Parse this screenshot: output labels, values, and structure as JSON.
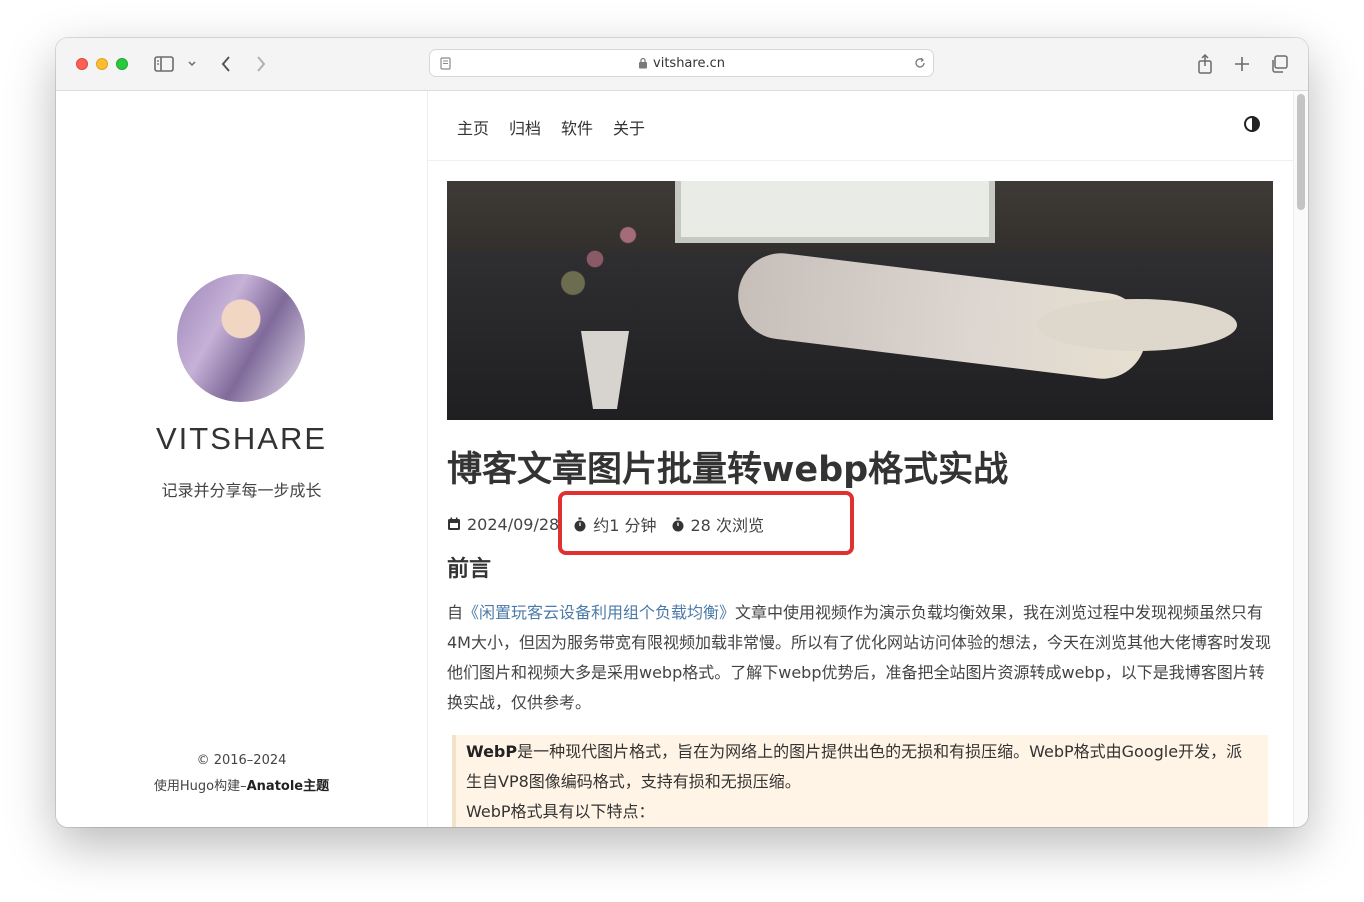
{
  "browser": {
    "url": "vitshare.cn",
    "icons": [
      "sidebar-icon",
      "chevron-down-icon",
      "back-icon",
      "forward-icon",
      "reader-icon",
      "lock-icon",
      "reload-icon",
      "share-icon",
      "new-tab-icon",
      "tabs-overview-icon"
    ]
  },
  "site": {
    "name": "VITSHARE",
    "tagline": "记录并分享每一步成长",
    "footer_copyright": "© 2016–2024",
    "footer_built_prefix": "使用Hugo构建–",
    "footer_theme": "Anatole主题"
  },
  "nav": {
    "items": [
      "主页",
      "归档",
      "软件",
      "关于"
    ],
    "theme_toggle_icon": "theme-toggle-icon"
  },
  "article": {
    "title": "博客文章图片批量转webp格式实战",
    "date": "2024/09/28",
    "read_time": "约1 分钟",
    "views": "28 次浏览",
    "section_heading": "前言",
    "para_prefix": "自",
    "para_link": "《闲置玩客云设备利用组个负载均衡》",
    "para_rest": "文章中使用视频作为演示负载均衡效果，我在浏览过程中发现视频虽然只有4M大小，但因为服务带宽有限视频加载非常慢。所以有了优化网站访问体验的想法，今天在浏览其他大佬博客时发现他们图片和视频大多是采用webp格式。了解下webp优势后，准备把全站图片资源转成webp，以下是我博客图片转换实战，仅供参考。",
    "quote_bold": "WebP",
    "quote_line1": "是一种现代图片格式，旨在为网络上的图片提供出色的无损和有损压缩。WebP格式由Google开发，派生自VP8图像编码格式，支持有损和无损压缩。",
    "quote_line2": "WebP格式具有以下特点："
  },
  "colors": {
    "highlight": "#e03131",
    "link": "#4c7aa8",
    "quote_bg": "#fff4e5"
  }
}
